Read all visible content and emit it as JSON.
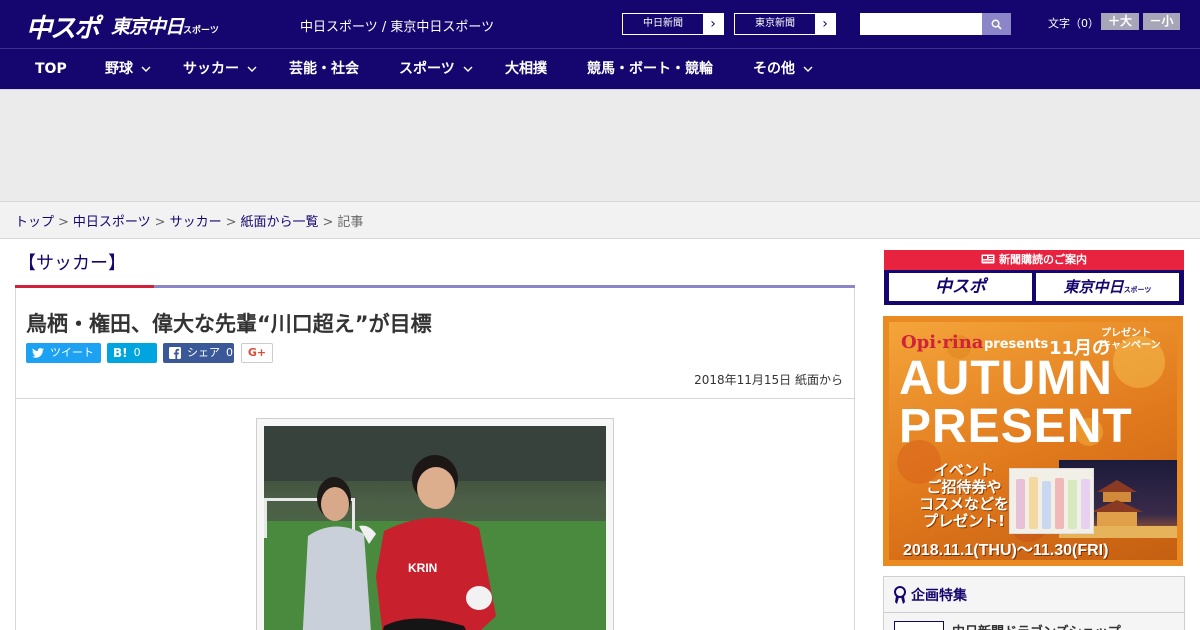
{
  "header": {
    "logo_main": "中スポ",
    "logo_tokyo": "東京中日",
    "logo_tokyo_small": "スポーツ",
    "site_title": "中日スポーツ / 東京中日スポーツ",
    "link_chunichi": "中日新聞",
    "link_tokyo": "東京新聞",
    "link_arrow": "›",
    "search_placeholder": "",
    "font_label": "文字（0）",
    "font_up": "＋大",
    "font_down": "－小"
  },
  "nav": {
    "items": [
      {
        "label": "TOP",
        "has_menu": false
      },
      {
        "label": "野球",
        "has_menu": true
      },
      {
        "label": "サッカー",
        "has_menu": true
      },
      {
        "label": "芸能・社会",
        "has_menu": false
      },
      {
        "label": "スポーツ",
        "has_menu": true
      },
      {
        "label": "大相撲",
        "has_menu": false
      },
      {
        "label": "競馬・ボート・競輪",
        "has_menu": false
      },
      {
        "label": "その他",
        "has_menu": true
      }
    ]
  },
  "breadcrumb": {
    "items": [
      "トップ",
      "中日スポーツ",
      "サッカー",
      "紙面から一覧"
    ],
    "current": "記事",
    "separator": ">"
  },
  "article": {
    "category": "【サッカー】",
    "headline": "鳥栖・権田、偉大な先輩“川口超え”が目標",
    "share": {
      "tweet": "ツイート",
      "hatena": "B!",
      "hatena_count": "0",
      "facebook": "シェア",
      "facebook_count": "0",
      "gplus": "G+"
    },
    "dateline": "2018年11月15日 紙面から",
    "photo_jersey_text": "KRIN"
  },
  "sidebar": {
    "subscribe_head": "新聞購読のご案内",
    "subscribe_logo_1": "中スポ",
    "subscribe_logo_2": "東京中日",
    "subscribe_logo_2_small": "スポーツ",
    "promo": {
      "brand": "Opi·rina",
      "presents": "presents",
      "month": "11月の",
      "campaign_line1": "プレゼント",
      "campaign_line2": "キャンペーン",
      "title_1": "AUTUMN",
      "title_2": "PRESENT",
      "body_1": "イベント",
      "body_2": "ご招待券や",
      "body_3": "コスメなどを",
      "body_4": "プレゼント!",
      "date": "2018.11.1(THU)～11.30(FRI)"
    },
    "feature_head": "企画特集",
    "feature_item": "中日新聞ドラゴンズショップ"
  },
  "colors": {
    "brand_navy": "#15066f",
    "accent_red": "#d0223a",
    "accent_purple": "#8a86c8",
    "twitter": "#1da1f2",
    "hatena": "#00a4de",
    "facebook": "#3b5998"
  }
}
